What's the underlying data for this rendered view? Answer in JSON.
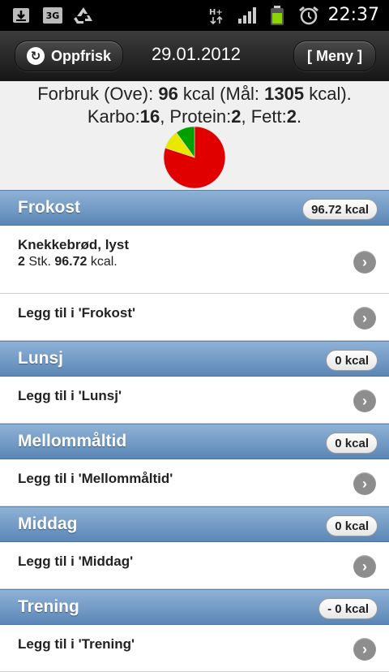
{
  "status_bar": {
    "time": "22:37",
    "network": "3G",
    "signal_label": "H+"
  },
  "header": {
    "refresh_label": "Oppfrisk",
    "date": "29.01.2012",
    "menu_label": "[ Meny ]"
  },
  "summary": {
    "prefix": "Forbruk (Ove): ",
    "consumed_kcal": "96",
    "kcal_mid": " kcal (Mål: ",
    "goal_kcal": "1305",
    "kcal_end": " kcal).",
    "carbs_label": "Karbo:",
    "carbs": "16",
    "protein_label": ", Protein:",
    "protein": "2",
    "fat_label": ", Fett:",
    "fat": "2",
    "end": "."
  },
  "chart_data": {
    "type": "pie",
    "slices": [
      {
        "label": "Karbo",
        "value": 16,
        "color": "#e00000"
      },
      {
        "label": "Protein",
        "value": 2,
        "color": "#e8e800"
      },
      {
        "label": "Fett",
        "value": 2,
        "color": "#00a000"
      }
    ]
  },
  "sections": [
    {
      "name": "Frokost",
      "kcal": "96.72 kcal",
      "entries": [
        {
          "title": "Knekkebrød, lyst",
          "qty": "2",
          "unit": " Stk. ",
          "kcal": "96.72",
          "kcal_unit": " kcal."
        }
      ],
      "add_label": "Legg til i 'Frokost'"
    },
    {
      "name": "Lunsj",
      "kcal": "0 kcal",
      "entries": [],
      "add_label": "Legg til i 'Lunsj'"
    },
    {
      "name": "Mellommåltid",
      "kcal": "0 kcal",
      "entries": [],
      "add_label": "Legg til i 'Mellommåltid'"
    },
    {
      "name": "Middag",
      "kcal": "0 kcal",
      "entries": [],
      "add_label": "Legg til i 'Middag'"
    },
    {
      "name": "Trening",
      "kcal": "- 0 kcal",
      "entries": [],
      "add_label": "Legg til i 'Trening'"
    }
  ],
  "colors": {
    "section_header": "#6f97c4",
    "pie_carbs": "#e00000",
    "pie_protein": "#e8e800",
    "pie_fat": "#00a000"
  }
}
